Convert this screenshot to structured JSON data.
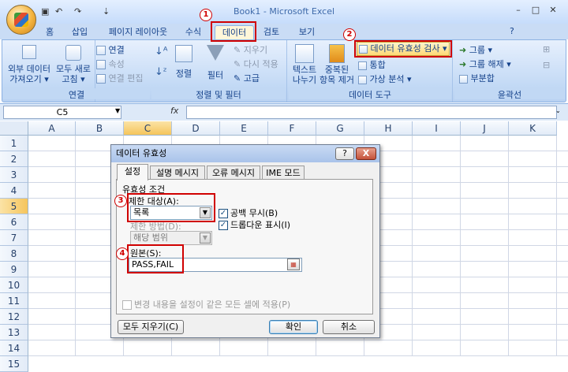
{
  "window": {
    "title": "Book1 - Microsoft Excel"
  },
  "tabs": [
    "홈",
    "삽입",
    "페이지 레이아웃",
    "수식",
    "데이터",
    "검토",
    "보기"
  ],
  "ribbon": {
    "get_external": "외부 데이터\n가져오기 ▾",
    "refresh_all": "모두 새로\n고침 ▾",
    "connections": "연결",
    "properties": "속성",
    "edit_links": "연결 편집",
    "group_connections": "연결",
    "sort": "정렬",
    "filter": "필터",
    "clear": "지우기",
    "reapply": "다시 적용",
    "advanced": "고급",
    "group_sort": "정렬 및 필터",
    "text_to_columns": "텍스트\n나누기",
    "remove_dup": "중복된\n항목 제거",
    "data_validation": "데이터 유효성 검사 ▾",
    "consolidate": "통합",
    "what_if": "가상 분석 ▾",
    "group_tools": "데이터 도구",
    "group_btn": "그룹 ▾",
    "ungroup_btn": "그룹 해제 ▾",
    "subtotal": "부분합",
    "group_outline": "윤곽선"
  },
  "formula_bar": {
    "name_box": "C5",
    "fx": "fx"
  },
  "columns": [
    "A",
    "B",
    "C",
    "D",
    "E",
    "F",
    "G",
    "H",
    "I",
    "J",
    "K"
  ],
  "rows": [
    "1",
    "2",
    "3",
    "4",
    "5",
    "6",
    "7",
    "8",
    "9",
    "10",
    "11",
    "12",
    "13",
    "14",
    "15"
  ],
  "dialog": {
    "title": "데이터 유효성",
    "help": "?",
    "close": "X",
    "tabs": [
      "설정",
      "설명 메시지",
      "오류 메시지",
      "IME 모드"
    ],
    "section": "유효성 조건",
    "allow_label": "제한 대상(A):",
    "allow_value": "목록",
    "ignore_blank": "공백 무시(B)",
    "dropdown": "드롭다운 표시(I)",
    "data_label": "제한 방법(D):",
    "data_value": "해당 범위",
    "source_label": "원본(S):",
    "source_value": "PASS,FAIL",
    "apply_all": "변경 내용을 설정이 같은 모든 셀에 적용(P)",
    "clear_all": "모두 지우기(C)",
    "ok": "확인",
    "cancel": "취소"
  },
  "annotations": [
    "1",
    "2",
    "3",
    "4"
  ],
  "colors": {
    "accent": "#d00000",
    "ribbon": "#c2d9f5"
  }
}
